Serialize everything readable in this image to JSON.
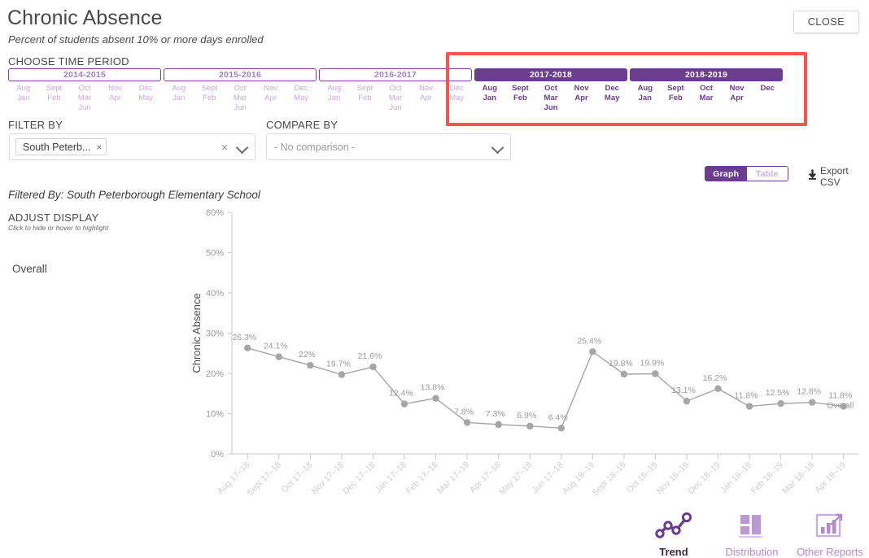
{
  "header": {
    "title": "Chronic Absence",
    "subtitle": "Percent of students absent 10% or more days enrolled",
    "close_label": "CLOSE"
  },
  "time_period": {
    "label": "CHOOSE TIME PERIOD",
    "highlight_color": "#f9544b",
    "accent_color": "#6b3d8e",
    "periods": [
      {
        "year": "2014-2015",
        "selected": false,
        "months": [
          [
            "Aug",
            "Jan"
          ],
          [
            "Sept",
            "Feb"
          ],
          [
            "Oct",
            "Mar",
            "Jun"
          ],
          [
            "Nov",
            "Apr"
          ],
          [
            "Dec",
            "May"
          ]
        ]
      },
      {
        "year": "2015-2016",
        "selected": false,
        "months": [
          [
            "Aug",
            "Jan"
          ],
          [
            "Sept",
            "Feb"
          ],
          [
            "Oct",
            "Mar",
            "Jun"
          ],
          [
            "Nov",
            "Apr"
          ],
          [
            "Dec",
            "May"
          ]
        ]
      },
      {
        "year": "2016-2017",
        "selected": false,
        "months": [
          [
            "Aug",
            "Jan"
          ],
          [
            "Sept",
            "Feb"
          ],
          [
            "Oct",
            "Mar",
            "Jun"
          ],
          [
            "Nov",
            "Apr"
          ],
          [
            "Dec",
            "May"
          ]
        ]
      },
      {
        "year": "2017-2018",
        "selected": true,
        "months": [
          [
            "Aug",
            "Jan"
          ],
          [
            "Sept",
            "Feb"
          ],
          [
            "Oct",
            "Mar",
            "Jun"
          ],
          [
            "Nov",
            "Apr"
          ],
          [
            "Dec",
            "May"
          ]
        ]
      },
      {
        "year": "2018-2019",
        "selected": true,
        "months": [
          [
            "Aug",
            "Jan"
          ],
          [
            "Sept",
            "Feb"
          ],
          [
            "Oct",
            "Mar"
          ],
          [
            "Nov",
            "Apr"
          ],
          [
            "Dec"
          ]
        ]
      }
    ]
  },
  "filters": {
    "filter_by_label": "FILTER BY",
    "filter_chip": "South Peterb...",
    "filter_chip_remove": "×",
    "filter_clear": "×",
    "compare_by_label": "COMPARE BY",
    "compare_by_value": "- No comparison -"
  },
  "toolbar": {
    "graph_label": "Graph",
    "table_label": "Table",
    "export_label": "Export CSV",
    "active_view": "Graph"
  },
  "filtered_by_text": "Filtered By: South Peterborough Elementary School",
  "adjust_display": {
    "title": "ADJUST DISPLAY",
    "hint": "Click to hide or hover to highlight",
    "series": [
      {
        "label": "Overall",
        "color": "#a6a6a6"
      }
    ]
  },
  "footer_nav": [
    {
      "label": "Trend",
      "icon": "trend-icon",
      "active": true
    },
    {
      "label": "Distribution",
      "icon": "distribution-icon",
      "active": false
    },
    {
      "label": "Other Reports",
      "icon": "other-reports-icon",
      "active": false
    }
  ],
  "chart_data": {
    "type": "line",
    "title": "",
    "xlabel": "",
    "ylabel": "Chronic Absence",
    "ylim": [
      0,
      60
    ],
    "ytick_labels": [
      "0%",
      "10%",
      "20%",
      "30%",
      "40%",
      "50%",
      "60%"
    ],
    "yticks": [
      0,
      10,
      20,
      30,
      40,
      50,
      60
    ],
    "grid": false,
    "legend": "left",
    "series_color": "#a6a6a6",
    "end_label": "Overall",
    "categories": [
      "Aug 17–18",
      "Sept 17–18",
      "Oct 17–18",
      "Nov 17–18",
      "Dec 17–18",
      "Jan 17–18",
      "Feb 17–18",
      "Mar 17–18",
      "Apr 17–18",
      "May 17–18",
      "Jun 17–18",
      "Aug 18–19",
      "Sept 18–19",
      "Oct 18–19",
      "Nov 18–19",
      "Dec 18–19",
      "Jan 18–19",
      "Feb 18–19",
      "Mar 18–19",
      "Apr 18–19"
    ],
    "series": [
      {
        "name": "Overall",
        "values": [
          26.3,
          24.1,
          22.0,
          19.7,
          21.6,
          12.4,
          13.8,
          7.8,
          7.3,
          6.9,
          6.4,
          25.4,
          19.8,
          19.9,
          13.1,
          16.2,
          11.8,
          12.5,
          12.8,
          11.8
        ],
        "labels": [
          "26.3%",
          "24.1%",
          "22%",
          "19.7%",
          "21.6%",
          "12.4%",
          "13.8%",
          "7.8%",
          "7.3%",
          "6.9%",
          "6.4%",
          "25.4%",
          "19.8%",
          "19.9%",
          "13.1%",
          "16.2%",
          "11.8%",
          "12.5%",
          "12.8%",
          "11.8%"
        ]
      }
    ]
  }
}
